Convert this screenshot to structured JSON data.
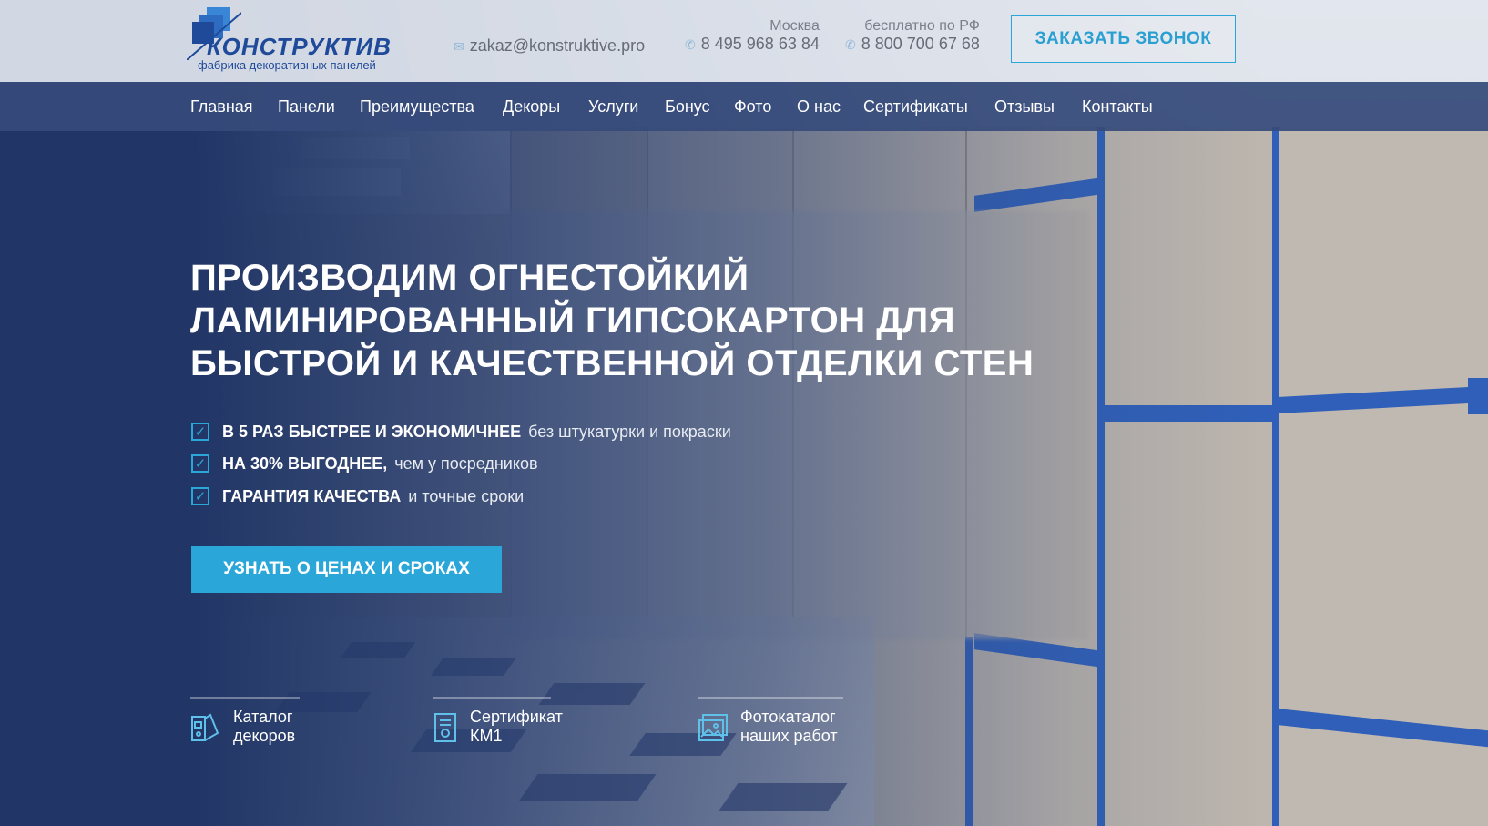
{
  "header": {
    "logo_name": "КОНСТРУКТИВ",
    "logo_tagline": "фабрика декоративных панелей",
    "email": "zakaz@konstruktive.pro",
    "phone_moscow_label": "Москва",
    "phone_moscow": "8 495 968 63 84",
    "phone_free_label": "бесплатно по РФ",
    "phone_free": "8 800 700 67 68",
    "callback_button": "ЗАКАЗАТЬ ЗВОНОК"
  },
  "nav": {
    "items": [
      "Главная",
      "Панели",
      "Преимущества",
      "Декоры",
      "Услуги",
      "Бонус",
      "Фото",
      "О нас",
      "Сертификаты",
      "Отзывы",
      "Контакты"
    ]
  },
  "hero": {
    "headline_lines": [
      "ПРОИЗВОДИМ ОГНЕСТОЙКИЙ",
      "ЛАМИНИРОВАННЫЙ ГИПСОКАРТОН ДЛЯ",
      "БЫСТРОЙ И КАЧЕСТВЕННОЙ ОТДЕЛКИ СТЕН"
    ],
    "benefits": [
      {
        "strong": "В 5 РАЗ БЫСТРЕЕ И ЭКОНОМИЧНЕЕ",
        "light": "без штукатурки и покраски"
      },
      {
        "strong": "НА 30% ВЫГОДНЕЕ,",
        "light": "чем у посредников"
      },
      {
        "strong": "ГАРАНТИЯ КАЧЕСТВА",
        "light": "и точные сроки"
      }
    ],
    "cta_button": "УЗНАТЬ О ЦЕНАХ И СРОКАХ"
  },
  "quick_links": [
    {
      "line1": "Каталог",
      "line2": "декоров",
      "icon": "catalog-icon"
    },
    {
      "line1": "Сертификат",
      "line2": "КМ1",
      "icon": "certificate-icon"
    },
    {
      "line1": "Фотокаталог",
      "line2": "наших работ",
      "icon": "photo-gallery-icon"
    }
  ],
  "colors": {
    "accent": "#2aa7d8",
    "brand_blue": "#1f4a9a",
    "nav_bg": "#364b7b",
    "overlay_navy": "#213666"
  }
}
